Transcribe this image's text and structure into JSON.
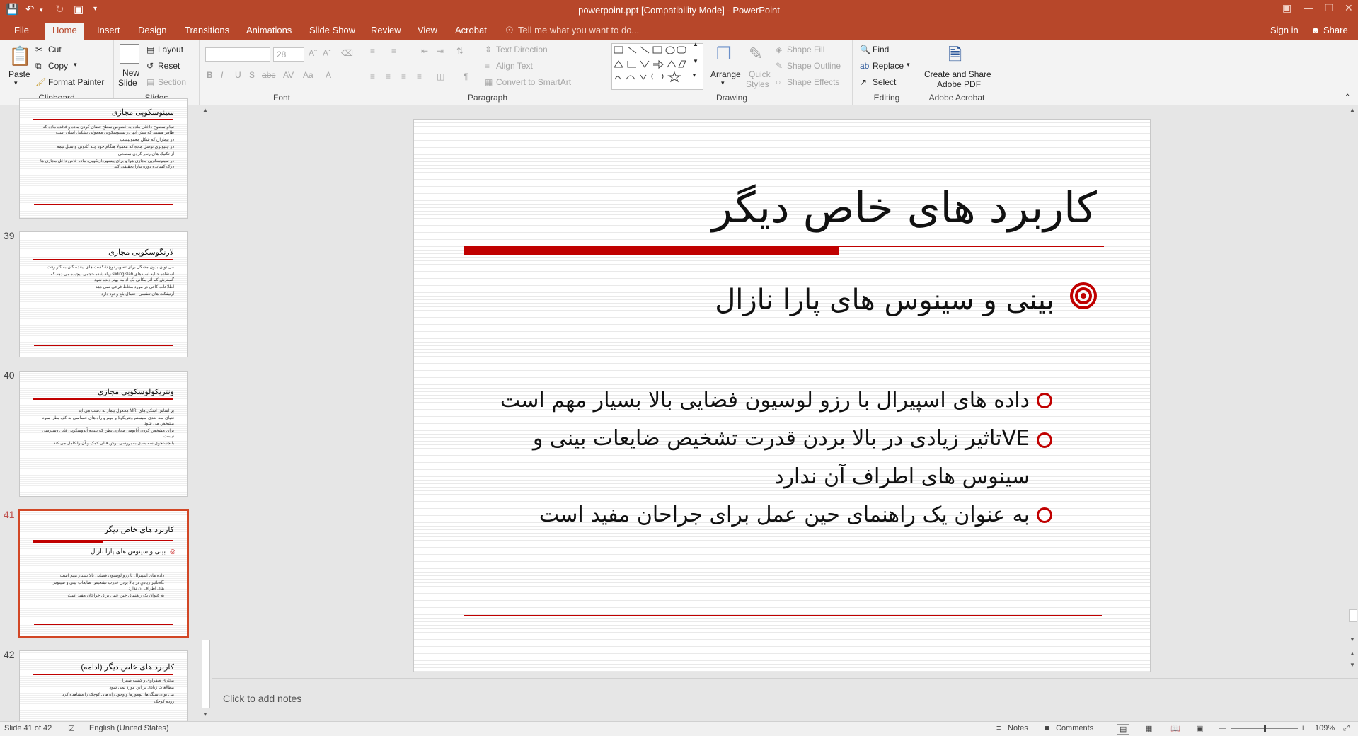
{
  "window": {
    "title": "powerpoint.ppt [Compatibility Mode] - PowerPoint",
    "sign_in": "Sign in",
    "share": "Share"
  },
  "tabs": [
    "File",
    "Home",
    "Insert",
    "Design",
    "Transitions",
    "Animations",
    "Slide Show",
    "Review",
    "View",
    "Acrobat"
  ],
  "tell_me": "Tell me what you want to do...",
  "ribbon": {
    "clipboard": {
      "label": "Clipboard",
      "paste": "Paste",
      "cut": "Cut",
      "copy": "Copy",
      "format_painter": "Format Painter"
    },
    "slides": {
      "label": "Slides",
      "new_slide_1": "New",
      "new_slide_2": "Slide",
      "layout": "Layout",
      "reset": "Reset",
      "section": "Section"
    },
    "font": {
      "label": "Font",
      "font_size": "28"
    },
    "paragraph": {
      "label": "Paragraph",
      "text_direction": "Text Direction",
      "align_text": "Align Text",
      "convert_smartart": "Convert to SmartArt"
    },
    "drawing": {
      "label": "Drawing",
      "arrange": "Arrange",
      "quick_styles_1": "Quick",
      "quick_styles_2": "Styles",
      "shape_fill": "Shape Fill",
      "shape_outline": "Shape Outline",
      "shape_effects": "Shape Effects"
    },
    "editing": {
      "label": "Editing",
      "find": "Find",
      "replace": "Replace",
      "select": "Select"
    },
    "acrobat": {
      "label": "Adobe Acrobat",
      "create_1": "Create and Share",
      "create_2": "Adobe PDF"
    }
  },
  "thumbnails": [
    {
      "number": "",
      "title": "سینوسکوپی مجازی",
      "lines": [
        "تمام سطوح داخلی ماده به خصوص سطح فضای گردن ماده و فاقده ماده که ظاهر هستند که بیش آنها در سینوسکوپی معمولی تشکیل آسان است",
        "در بیماران که شکل معمولیست",
        "در چنیوبری توسل ماده که معمولا هنگام خود چند کانونی و سیل نیمه",
        "از تکنیک های رندر کردن سطحی",
        "در سینوسکوپی مجازی هوا و برای پیشهرداریکوپی، ماده خاص داخل مجاری ها درک کشانده دوره تیارا نحقیقی کند"
      ]
    },
    {
      "number": "39",
      "title": "لارنگوسکوپی مجازی",
      "lines": [
        "می توان بدون مشکل برای تصویر نوع شکست های بیننده گان به کار رفت",
        "استفاده حالیه اسیدهای sliding slab زیاد شده حجمی بیچیده می دهد که گسترش کم اثر مکانی یک ادامه بهتر دیده شود",
        "اطلاعات کافی در مورد مخاط فرعی نمی دهد",
        "آرتیفکت های تنفسی احتمال بلع وجود دارد"
      ]
    },
    {
      "number": "40",
      "title": "ونتریکولوسکوپی مجازی",
      "lines": [
        "بر اساس اسکن های MRI مجعول بیمار به دست می آید",
        "تعیای سه بعدی سیستم ونتریکولا و مهم و راه های عساسی به کف بطن سوم مشخص می شود",
        "برای مشخص کردن آناتومی مجاری بطن که نتیجه آندوسکوپی قابل دسترسی نیست",
        "با جستجوی سه بعدی به بررسی برش قبلی کمک و آن را کامل می کند"
      ]
    },
    {
      "number": "41",
      "title": "کاربرد های خاص دیگر",
      "sub": "بینی و سینوس های پارا نازال",
      "lines": [
        "داده های اسپیرال با رزو لوسیون فضایی بالا بسیار مهم است",
        "VEتاثیر زیادی در بالا بردن قدرت تشخیص ضایعات بینی و سینوس های اطراف آن ندارد",
        "به عنوان یک راهنمای حین عمل برای جراحان مفید است"
      ]
    },
    {
      "number": "42",
      "title": "کاربرد های خاص دیگر  (ادامه)",
      "lines": [
        "مجاری صفراوی و کیسه صفرا",
        "مطالعات زیادی بر این مورد نمی شود",
        "می توان سنگ ها، تومورها و وجود راه های کوچک را مشاهده کرد",
        "روده کوچک"
      ]
    }
  ],
  "slide": {
    "title": "کاربرد های خاص دیگر",
    "subtitle": "بینی و سینوس های پارا نازال",
    "bullets": [
      "داده های اسپیرال با رزو لوسیون فضایی بالا بسیار مهم است",
      "VEتاثیر زیادی در بالا بردن قدرت تشخیص ضایعات بینی و سینوس های اطراف آن ندارد",
      "به عنوان یک راهنمای حین عمل برای جراحان مفید است"
    ]
  },
  "notes_placeholder": "Click to add notes",
  "status": {
    "slide_of": "Slide 41 of 42",
    "language": "English (United States)",
    "notes": "Notes",
    "comments": "Comments",
    "zoom": "109%"
  },
  "colors": {
    "accent": "#b7472a",
    "slide_red": "#c00000"
  }
}
